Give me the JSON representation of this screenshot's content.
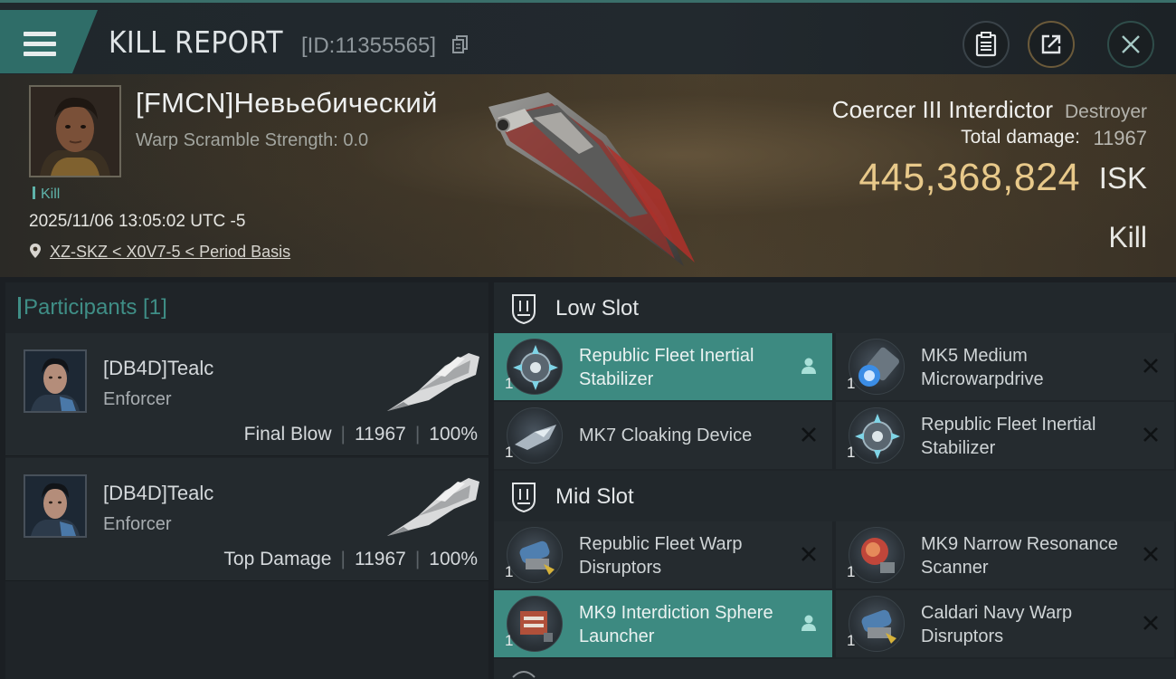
{
  "header": {
    "title": "KILL REPORT",
    "report_id": "[ID:11355565]"
  },
  "victim": {
    "name": "[FMCN]Невьебический",
    "warp_scramble": "Warp Scramble Strength: 0.0",
    "tag": "Kill",
    "time": "2025/11/06 13:05:02 UTC -5",
    "location": "XZ-SKZ < X0V7-5 < Period Basis",
    "ship_name": "Coercer III Interdictor",
    "ship_class": "Destroyer",
    "total_damage_label": "Total damage:",
    "total_damage_value": "11967",
    "isk_value": "445,368,824",
    "isk_unit": "ISK",
    "result": "Kill"
  },
  "participants": {
    "title": "Participants [1]",
    "items": [
      {
        "name": "[DB4D]Tealc",
        "ship": "Enforcer",
        "role": "Final Blow",
        "damage": "11967",
        "percent": "100%"
      },
      {
        "name": "[DB4D]Tealc",
        "ship": "Enforcer",
        "role": "Top Damage",
        "damage": "11967",
        "percent": "100%"
      }
    ]
  },
  "fitting": {
    "low_slot": {
      "title": "Low Slot",
      "modules": [
        {
          "name": "Republic Fleet Inertial Stabilizer",
          "qty": "1",
          "status": "person",
          "highlight": true
        },
        {
          "name": "MK5 Medium Microwarpdrive",
          "qty": "1",
          "status": "destroyed",
          "highlight": false
        },
        {
          "name": "MK7 Cloaking Device",
          "qty": "1",
          "status": "destroyed",
          "highlight": false
        },
        {
          "name": "Republic Fleet Inertial Stabilizer",
          "qty": "1",
          "status": "destroyed",
          "highlight": false
        }
      ]
    },
    "mid_slot": {
      "title": "Mid Slot",
      "modules": [
        {
          "name": "Republic Fleet Warp Disruptors",
          "qty": "1",
          "status": "destroyed",
          "highlight": false
        },
        {
          "name": "MK9 Narrow Resonance Scanner",
          "qty": "1",
          "status": "destroyed",
          "highlight": false
        },
        {
          "name": "MK9 Interdiction Sphere Launcher",
          "qty": "1",
          "status": "person",
          "highlight": true
        },
        {
          "name": "Caldari Navy Warp Disruptors",
          "qty": "1",
          "status": "destroyed",
          "highlight": false
        }
      ]
    }
  },
  "colors": {
    "accent_teal": "#3d8a81",
    "isk_gold": "#e8c98a"
  }
}
